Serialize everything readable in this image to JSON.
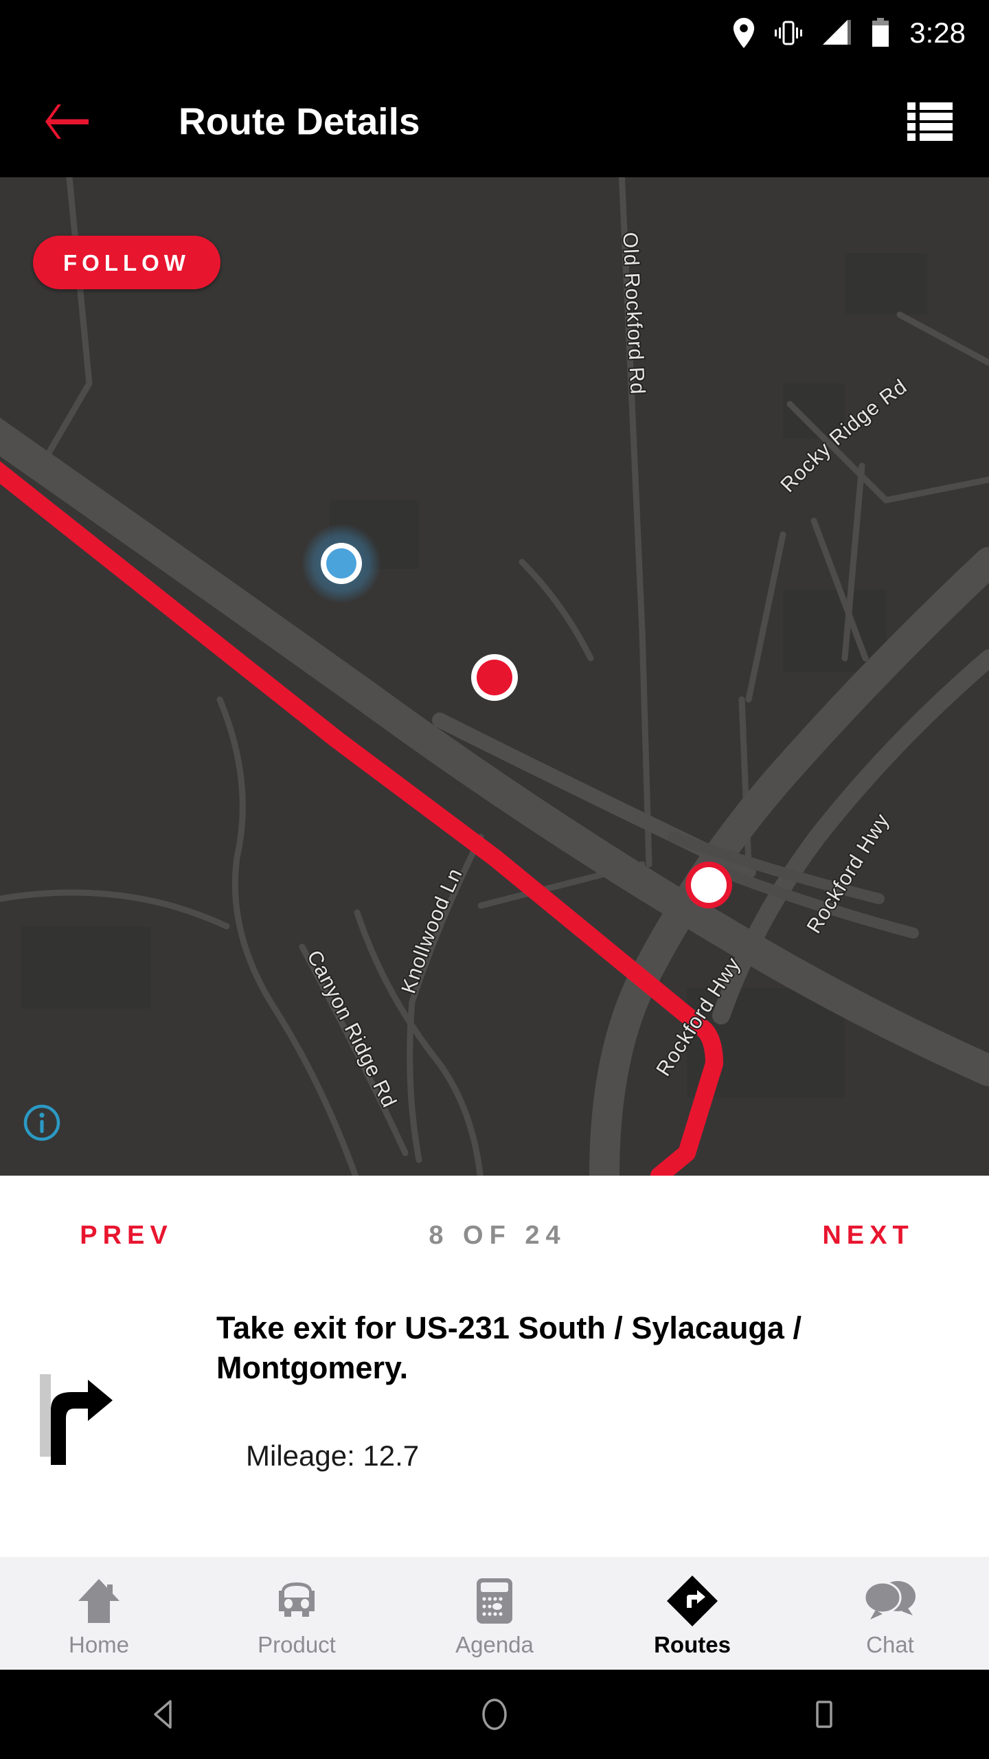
{
  "status_bar": {
    "time": "3:28",
    "icons": [
      "location-pin-icon",
      "vibrate-icon",
      "signal-icon",
      "battery-icon"
    ]
  },
  "app_bar": {
    "title": "Route Details",
    "back_icon": "back-arrow-icon",
    "menu_icon": "list-icon",
    "accent_color": "#E8152F",
    "background_color": "#000000"
  },
  "map": {
    "follow_button_label": "FOLLOW",
    "info_icon": "info-icon",
    "background_color": "#373635",
    "road_color": "#4a4948",
    "route_color": "#E8152F",
    "labels": [
      "Old Rockford Rd",
      "Rocky Ridge Rd",
      "Rockford Hwy",
      "Knollwood Ln",
      "Canyon Ridge Rd",
      "Rockford Hwy"
    ],
    "markers": [
      {
        "name": "current-location-marker",
        "type": "blue-dot"
      },
      {
        "name": "waypoint-marker",
        "type": "red-dot"
      },
      {
        "name": "maneuver-marker",
        "type": "white-dot"
      }
    ]
  },
  "step_nav": {
    "prev_label": "PREV",
    "counter": "8 OF 24",
    "next_label": "NEXT",
    "current_step": 8,
    "total_steps": 24
  },
  "instruction": {
    "maneuver_icon": "turn-right-exit-icon",
    "text": "Take exit for US-231 South / Sylacauga / Montgomery.",
    "mileage": "Mileage: 12.7"
  },
  "bottom_nav": {
    "items": [
      {
        "label": "Home",
        "icon": "home-icon",
        "active": false
      },
      {
        "label": "Product",
        "icon": "car-icon",
        "active": false
      },
      {
        "label": "Agenda",
        "icon": "calendar-icon",
        "active": false
      },
      {
        "label": "Routes",
        "icon": "directions-diamond-icon",
        "active": true
      },
      {
        "label": "Chat",
        "icon": "chat-bubbles-icon",
        "active": false
      }
    ]
  },
  "system_nav": {
    "back_icon": "android-back-icon",
    "home_icon": "android-home-icon",
    "recents_icon": "android-recents-icon"
  }
}
